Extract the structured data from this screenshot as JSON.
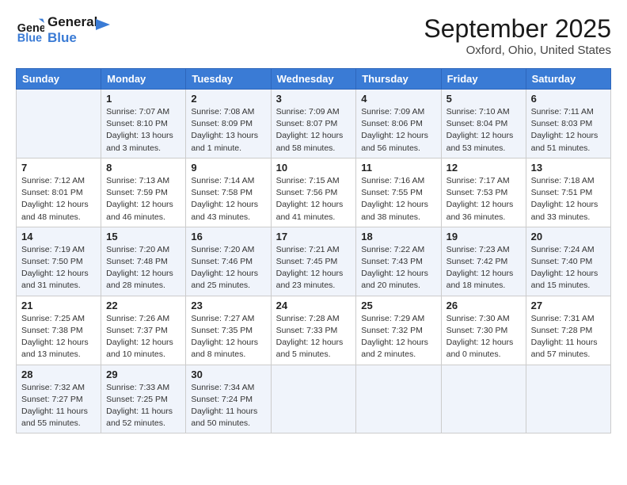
{
  "logo": {
    "line1": "General",
    "line2": "Blue"
  },
  "header": {
    "month": "September 2025",
    "location": "Oxford, Ohio, United States"
  },
  "weekdays": [
    "Sunday",
    "Monday",
    "Tuesday",
    "Wednesday",
    "Thursday",
    "Friday",
    "Saturday"
  ],
  "weeks": [
    [
      {
        "day": "",
        "info": ""
      },
      {
        "day": "1",
        "info": "Sunrise: 7:07 AM\nSunset: 8:10 PM\nDaylight: 13 hours\nand 3 minutes."
      },
      {
        "day": "2",
        "info": "Sunrise: 7:08 AM\nSunset: 8:09 PM\nDaylight: 13 hours\nand 1 minute."
      },
      {
        "day": "3",
        "info": "Sunrise: 7:09 AM\nSunset: 8:07 PM\nDaylight: 12 hours\nand 58 minutes."
      },
      {
        "day": "4",
        "info": "Sunrise: 7:09 AM\nSunset: 8:06 PM\nDaylight: 12 hours\nand 56 minutes."
      },
      {
        "day": "5",
        "info": "Sunrise: 7:10 AM\nSunset: 8:04 PM\nDaylight: 12 hours\nand 53 minutes."
      },
      {
        "day": "6",
        "info": "Sunrise: 7:11 AM\nSunset: 8:03 PM\nDaylight: 12 hours\nand 51 minutes."
      }
    ],
    [
      {
        "day": "7",
        "info": "Sunrise: 7:12 AM\nSunset: 8:01 PM\nDaylight: 12 hours\nand 48 minutes."
      },
      {
        "day": "8",
        "info": "Sunrise: 7:13 AM\nSunset: 7:59 PM\nDaylight: 12 hours\nand 46 minutes."
      },
      {
        "day": "9",
        "info": "Sunrise: 7:14 AM\nSunset: 7:58 PM\nDaylight: 12 hours\nand 43 minutes."
      },
      {
        "day": "10",
        "info": "Sunrise: 7:15 AM\nSunset: 7:56 PM\nDaylight: 12 hours\nand 41 minutes."
      },
      {
        "day": "11",
        "info": "Sunrise: 7:16 AM\nSunset: 7:55 PM\nDaylight: 12 hours\nand 38 minutes."
      },
      {
        "day": "12",
        "info": "Sunrise: 7:17 AM\nSunset: 7:53 PM\nDaylight: 12 hours\nand 36 minutes."
      },
      {
        "day": "13",
        "info": "Sunrise: 7:18 AM\nSunset: 7:51 PM\nDaylight: 12 hours\nand 33 minutes."
      }
    ],
    [
      {
        "day": "14",
        "info": "Sunrise: 7:19 AM\nSunset: 7:50 PM\nDaylight: 12 hours\nand 31 minutes."
      },
      {
        "day": "15",
        "info": "Sunrise: 7:20 AM\nSunset: 7:48 PM\nDaylight: 12 hours\nand 28 minutes."
      },
      {
        "day": "16",
        "info": "Sunrise: 7:20 AM\nSunset: 7:46 PM\nDaylight: 12 hours\nand 25 minutes."
      },
      {
        "day": "17",
        "info": "Sunrise: 7:21 AM\nSunset: 7:45 PM\nDaylight: 12 hours\nand 23 minutes."
      },
      {
        "day": "18",
        "info": "Sunrise: 7:22 AM\nSunset: 7:43 PM\nDaylight: 12 hours\nand 20 minutes."
      },
      {
        "day": "19",
        "info": "Sunrise: 7:23 AM\nSunset: 7:42 PM\nDaylight: 12 hours\nand 18 minutes."
      },
      {
        "day": "20",
        "info": "Sunrise: 7:24 AM\nSunset: 7:40 PM\nDaylight: 12 hours\nand 15 minutes."
      }
    ],
    [
      {
        "day": "21",
        "info": "Sunrise: 7:25 AM\nSunset: 7:38 PM\nDaylight: 12 hours\nand 13 minutes."
      },
      {
        "day": "22",
        "info": "Sunrise: 7:26 AM\nSunset: 7:37 PM\nDaylight: 12 hours\nand 10 minutes."
      },
      {
        "day": "23",
        "info": "Sunrise: 7:27 AM\nSunset: 7:35 PM\nDaylight: 12 hours\nand 8 minutes."
      },
      {
        "day": "24",
        "info": "Sunrise: 7:28 AM\nSunset: 7:33 PM\nDaylight: 12 hours\nand 5 minutes."
      },
      {
        "day": "25",
        "info": "Sunrise: 7:29 AM\nSunset: 7:32 PM\nDaylight: 12 hours\nand 2 minutes."
      },
      {
        "day": "26",
        "info": "Sunrise: 7:30 AM\nSunset: 7:30 PM\nDaylight: 12 hours\nand 0 minutes."
      },
      {
        "day": "27",
        "info": "Sunrise: 7:31 AM\nSunset: 7:28 PM\nDaylight: 11 hours\nand 57 minutes."
      }
    ],
    [
      {
        "day": "28",
        "info": "Sunrise: 7:32 AM\nSunset: 7:27 PM\nDaylight: 11 hours\nand 55 minutes."
      },
      {
        "day": "29",
        "info": "Sunrise: 7:33 AM\nSunset: 7:25 PM\nDaylight: 11 hours\nand 52 minutes."
      },
      {
        "day": "30",
        "info": "Sunrise: 7:34 AM\nSunset: 7:24 PM\nDaylight: 11 hours\nand 50 minutes."
      },
      {
        "day": "",
        "info": ""
      },
      {
        "day": "",
        "info": ""
      },
      {
        "day": "",
        "info": ""
      },
      {
        "day": "",
        "info": ""
      }
    ]
  ]
}
